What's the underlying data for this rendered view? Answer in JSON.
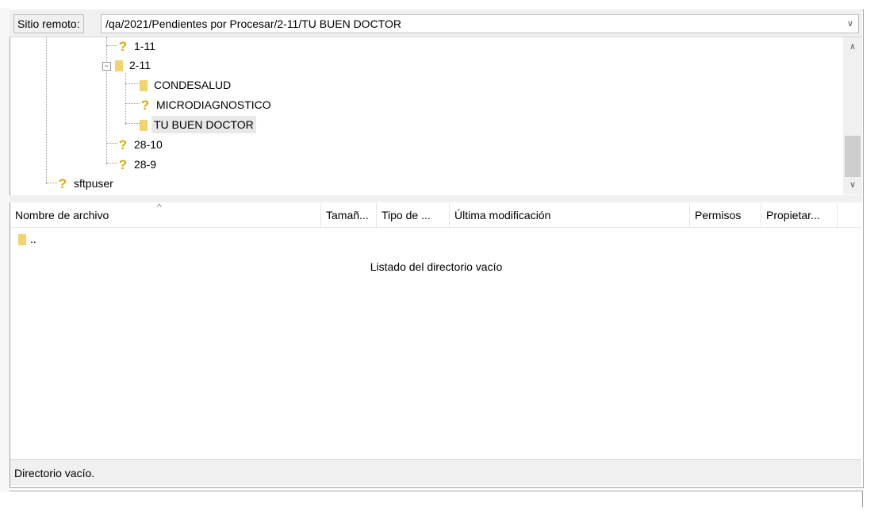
{
  "remote": {
    "label": "Sitio remoto:",
    "path": "/qa/2021/Pendientes por Procesar/2-11/TU BUEN DOCTOR"
  },
  "tree": {
    "nodes": [
      {
        "label": "1-11",
        "icon": "question-icon"
      },
      {
        "label": "2-11",
        "icon": "folder-icon",
        "expanded": true
      },
      {
        "label": "CONDESALUD",
        "icon": "folder-icon"
      },
      {
        "label": "MICRODIAGNOSTICO",
        "icon": "question-icon"
      },
      {
        "label": "TU BUEN DOCTOR",
        "icon": "folder-icon",
        "selected": true
      },
      {
        "label": "28-10",
        "icon": "question-icon"
      },
      {
        "label": "28-9",
        "icon": "question-icon"
      },
      {
        "label": "sftpuser",
        "icon": "question-icon"
      }
    ],
    "expander_symbol": "−"
  },
  "filelist": {
    "columns": [
      "Nombre de archivo",
      "Tamañ...",
      "Tipo de ...",
      "Última modificación",
      "Permisos",
      "Propietar..."
    ],
    "parent_entry": "..",
    "empty_message": "Listado del directorio vacío"
  },
  "status": {
    "text": "Directorio vacío."
  },
  "colors": {
    "folder": "#f3d26f",
    "question": "#e0a800",
    "selected_bg": "#e8e8e8"
  }
}
